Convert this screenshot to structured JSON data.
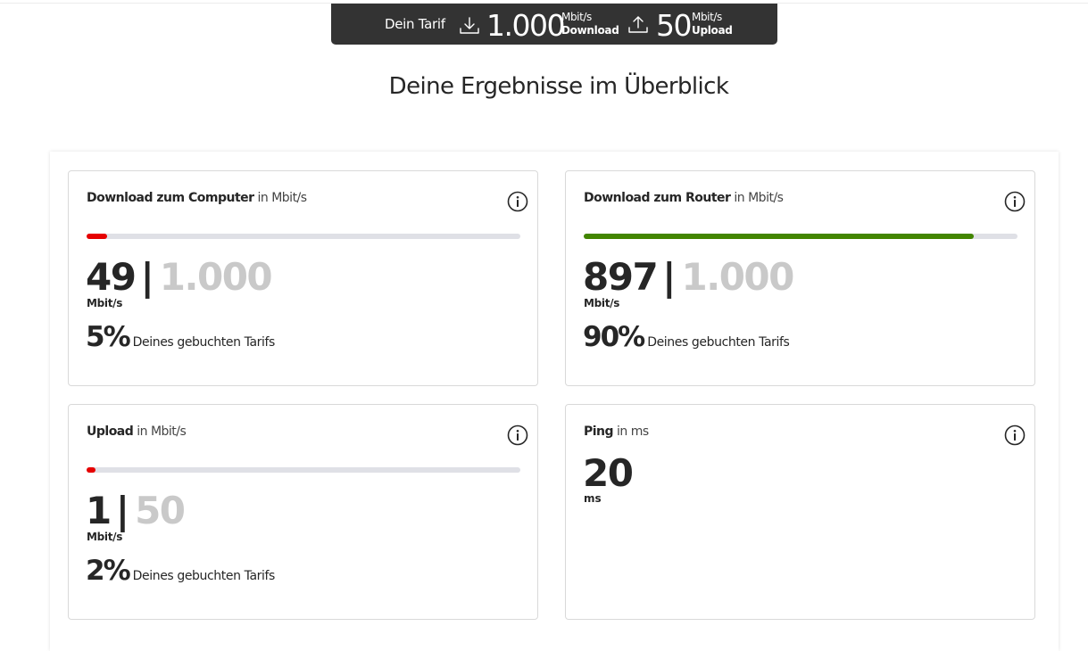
{
  "tariff": {
    "label": "Dein Tarif",
    "download_value": "1.000",
    "download_unit": "Mbit/s",
    "download_label": "Download",
    "upload_value": "50",
    "upload_unit": "Mbit/s",
    "upload_label": "Upload"
  },
  "page_title": "Deine Ergebnisse im Überblick",
  "cards": [
    {
      "title_bold": "Download zum Computer",
      "title_unit": "in Mbit/s",
      "value": "49",
      "max": "1.000",
      "unit": "Mbit/s",
      "percent": "5%",
      "percent_text": "Deines gebuchten Tarifs",
      "progress": 0.05,
      "bar_color": "#e60000"
    },
    {
      "title_bold": "Download zum Router",
      "title_unit": "in Mbit/s",
      "value": "897",
      "max": "1.000",
      "unit": "Mbit/s",
      "percent": "90%",
      "percent_text": "Deines gebuchten Tarifs",
      "progress": 0.9,
      "bar_color": "#428500"
    },
    {
      "title_bold": "Upload",
      "title_unit": "in Mbit/s",
      "value": "1",
      "max": "50",
      "unit": "Mbit/s",
      "percent": "2%",
      "percent_text": "Deines gebuchten Tarifs",
      "progress": 0.02,
      "bar_color": "#e60000"
    },
    {
      "title_bold": "Ping",
      "title_unit": "in ms",
      "value": "20",
      "unit": "ms"
    }
  ],
  "colors": {
    "tariff_bar_bg": "#333333",
    "text_dark": "#262626",
    "muted_value": "#c9c9c9",
    "track": "#dfe0e6"
  },
  "icons": [
    "download-icon",
    "upload-icon",
    "info-icon"
  ]
}
